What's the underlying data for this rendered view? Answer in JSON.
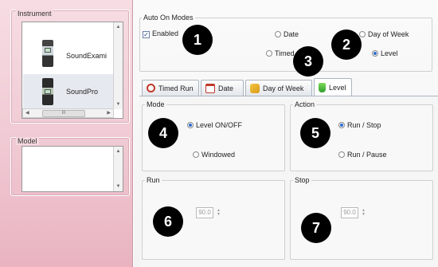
{
  "left_panel": {
    "instrument_group_label": "Instrument",
    "instruments": [
      {
        "name": "SoundExami"
      },
      {
        "name": "SoundPro"
      }
    ],
    "hscroll_thumb_label": "III",
    "model_group_label": "Model"
  },
  "auto_on": {
    "group_label": "Auto On Modes",
    "enabled_label": "Enabled",
    "enabled_checked": true,
    "options": {
      "date": "Date",
      "day_of_week": "Day of Week",
      "timed": "Timed",
      "level": "Level"
    },
    "selected": "level"
  },
  "tabs": [
    {
      "label": "Timed Run",
      "icon": "clock-icon"
    },
    {
      "label": "Date",
      "icon": "calendar-icon"
    },
    {
      "label": "Day of Week",
      "icon": "folder-icon"
    },
    {
      "label": "Level",
      "icon": "level-icon"
    }
  ],
  "active_tab": "Level",
  "mode": {
    "label": "Mode",
    "options": [
      "Level ON/OFF",
      "Windowed"
    ],
    "selected": "Level ON/OFF"
  },
  "action": {
    "label": "Action",
    "options": [
      "Run / Stop",
      "Run / Pause"
    ],
    "selected": "Run / Stop"
  },
  "run": {
    "label": "Run",
    "value": "90.0"
  },
  "stop": {
    "label": "Stop",
    "value": "90.0"
  },
  "callouts": [
    "1",
    "2",
    "3",
    "4",
    "5",
    "6",
    "7"
  ]
}
